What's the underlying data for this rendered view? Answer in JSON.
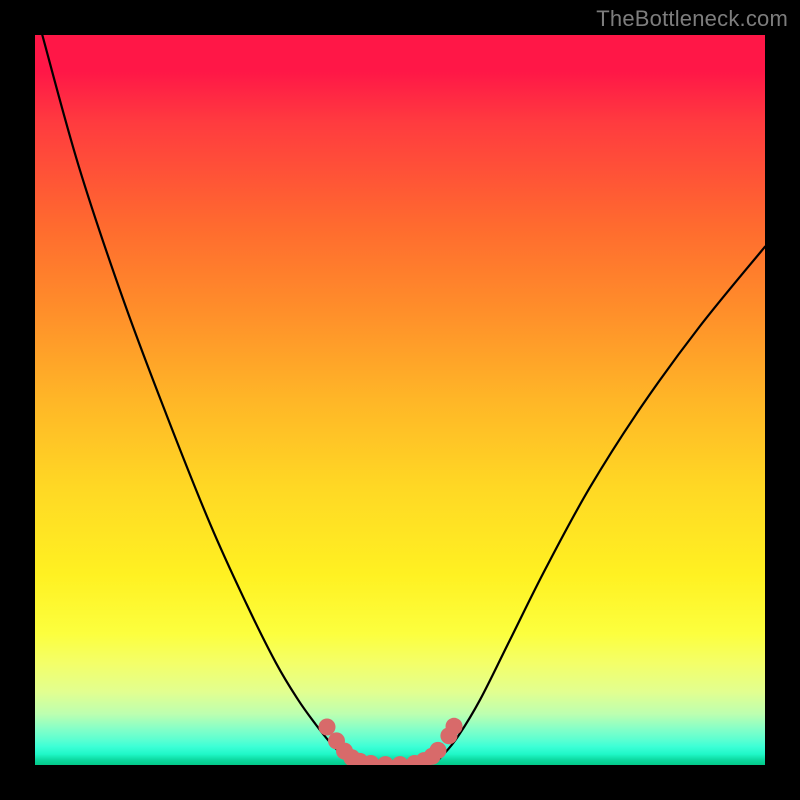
{
  "attribution": "TheBottleneck.com",
  "colors": {
    "frame": "#000000",
    "curve_stroke": "#000000",
    "marker_fill": "#d86a6a",
    "gradient_top": "#ff1747",
    "gradient_bottom": "#02c989"
  },
  "chart_data": {
    "type": "line",
    "title": "",
    "xlabel": "",
    "ylabel": "",
    "xlim": [
      0,
      100
    ],
    "ylim": [
      0,
      100
    ],
    "grid": false,
    "legend": false,
    "annotations": [
      "TheBottleneck.com"
    ],
    "series": [
      {
        "name": "left-branch",
        "x": [
          1,
          6,
          12,
          18,
          24,
          29,
          33,
          36,
          38.5,
          40.5,
          42,
          43,
          43.8
        ],
        "y": [
          100,
          82,
          64,
          48,
          33,
          22,
          14,
          9,
          5.5,
          3,
          1.5,
          0.7,
          0.3
        ]
      },
      {
        "name": "valley-floor",
        "x": [
          43.8,
          46,
          49,
          52,
          54.5
        ],
        "y": [
          0.3,
          0.05,
          0,
          0.05,
          0.3
        ]
      },
      {
        "name": "right-branch",
        "x": [
          54.5,
          56,
          58,
          61,
          65,
          70,
          76,
          83,
          91,
          100
        ],
        "y": [
          0.3,
          1.5,
          4,
          9,
          17,
          27,
          38,
          49,
          60,
          71
        ]
      }
    ],
    "markers": [
      {
        "x": 40.0,
        "y": 5.2
      },
      {
        "x": 41.3,
        "y": 3.3
      },
      {
        "x": 42.4,
        "y": 1.9
      },
      {
        "x": 43.4,
        "y": 1.0
      },
      {
        "x": 44.5,
        "y": 0.5
      },
      {
        "x": 46.0,
        "y": 0.2
      },
      {
        "x": 48.0,
        "y": 0.05
      },
      {
        "x": 50.0,
        "y": 0.05
      },
      {
        "x": 52.0,
        "y": 0.2
      },
      {
        "x": 53.3,
        "y": 0.6
      },
      {
        "x": 54.4,
        "y": 1.2
      },
      {
        "x": 55.2,
        "y": 2.0
      },
      {
        "x": 56.7,
        "y": 4.0
      },
      {
        "x": 57.4,
        "y": 5.3
      }
    ]
  }
}
